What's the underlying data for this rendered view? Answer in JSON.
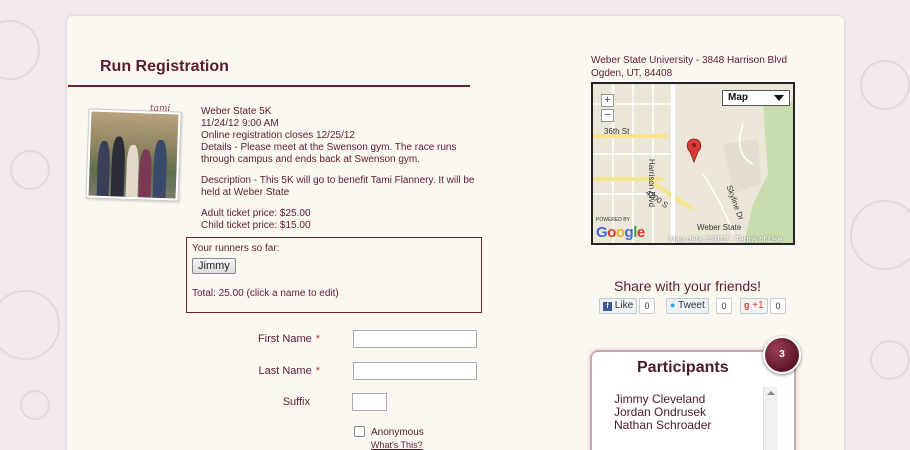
{
  "page": {
    "title": "Run Registration"
  },
  "event": {
    "name": "Weber State 5K",
    "datetime": "11/24/12 9:00 AM",
    "closes": "Online registration closes 12/25/12",
    "details": "Details - Please meet at the Swenson gym. The race runs through campus and ends back at Swenson gym.",
    "description": "Description - This 5K will go to benefit Tami Flannery. It will be held at Weber State",
    "adult_price": "Adult ticket price: $25.00",
    "child_price": "Child ticket price: $15.00",
    "photo_tag": "tami"
  },
  "runners": {
    "heading": "Your runners so far:",
    "names": [
      "Jimmy"
    ],
    "total": "Total: 25.00 (click a name to edit)"
  },
  "form": {
    "first_name_label": "First Name",
    "last_name_label": "Last Name",
    "suffix_label": "Suffix",
    "required_mark": "*",
    "first_name_value": "",
    "last_name_value": "",
    "suffix_value": "",
    "anonymous_label": "Anonymous",
    "whats_this": "What's This?"
  },
  "location": {
    "line1": "Weber State University - 3848 Harrison Blvd",
    "line2": "Ogden, UT, 84408"
  },
  "map": {
    "type_label": "Map",
    "zoom_in": "+",
    "zoom_out": "−",
    "labels": {
      "street_36": "36th St",
      "harrison": "Harrison Blvd",
      "st_4200": "4200 S",
      "skyline": "Skyline Dr",
      "weber_state": "Weber State",
      "powered_by": "POWERED BY",
      "credit": "Map data ©2012 - Terms of Use",
      "google": "Google"
    }
  },
  "share": {
    "title": "Share with your friends!",
    "like_label": "Like",
    "like_count": "0",
    "tweet_label": "Tweet",
    "tweet_count": "0",
    "plusone_label": "+1",
    "plusone_count": "0"
  },
  "participants": {
    "title": "Participants",
    "count": "3",
    "names": [
      "Jimmy Cleveland",
      "Jordan Ondrusek",
      "Nathan Schroader"
    ]
  },
  "colors": {
    "brand": "#5a1d2e",
    "accent_rule": "#6b2035",
    "panel_bg": "#fbf7f1",
    "page_bg": "#f1e9ec"
  }
}
